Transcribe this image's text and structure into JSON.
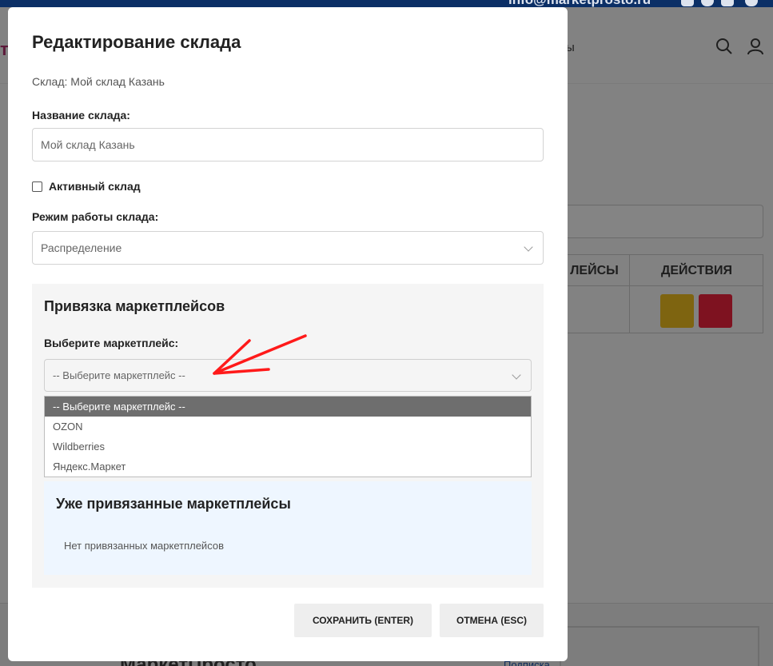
{
  "background": {
    "email": "info@marketprosto.ru",
    "nav_fragment": "ы",
    "table_headers": [
      "ЛЕЙСЫ",
      "ДЕЙСТВИЯ"
    ],
    "footer_logo": "МаркетПросто",
    "footer_link": "Подписка"
  },
  "modal": {
    "title": "Редактирование склада",
    "subtitle": "Склад: Мой склад Казань",
    "name_label": "Название склада:",
    "name_value": "Мой склад Казань",
    "active_label": "Активный склад",
    "mode_label": "Режим работы склада:",
    "mode_value": "Распределение",
    "marketplaces": {
      "title": "Привязка маркетплейсов",
      "select_label": "Выберите маркетплейс:",
      "select_value": "-- Выберите маркетплейс --",
      "options": [
        "-- Выберите маркетплейс --",
        "OZON",
        "Wildberries",
        "Яндекс.Маркет"
      ],
      "linked_title": "Уже привязанные маркетплейсы",
      "linked_empty": "Нет привязанных маркетплейсов"
    },
    "save_label": "СОХРАНИТЬ (ENTER)",
    "cancel_label": "ОТМЕНА (ESC)"
  },
  "colors": {
    "overlay": "#787878",
    "annotation_arrow": "#ff1a1a",
    "selected_option": "#6e6e6e",
    "linked_bg": "#eef6ff"
  }
}
